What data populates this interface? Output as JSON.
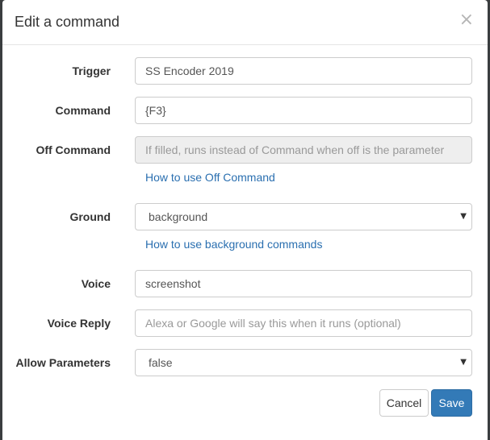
{
  "modal": {
    "title": "Edit a command",
    "close_glyph": "×"
  },
  "form": {
    "trigger": {
      "label": "Trigger",
      "value": "SS Encoder 2019"
    },
    "command": {
      "label": "Command",
      "value": "{F3}"
    },
    "off_command": {
      "label": "Off Command",
      "placeholder": "If filled, runs instead of Command when off is the parameter",
      "help_link": "How to use Off Command"
    },
    "ground": {
      "label": "Ground",
      "selected": "background",
      "help_link": "How to use background commands"
    },
    "voice": {
      "label": "Voice",
      "value": "screenshot"
    },
    "voice_reply": {
      "label": "Voice Reply",
      "placeholder": "Alexa or Google will say this when it runs (optional)"
    },
    "allow_parameters": {
      "label": "Allow Parameters",
      "selected": "false"
    }
  },
  "footer": {
    "cancel_label": "Cancel",
    "save_label": "Save"
  },
  "icons": {
    "close": "close-icon",
    "caret": "caret-down-icon"
  },
  "colors": {
    "primary": "#337ab7",
    "link": "#2a6fb0"
  }
}
